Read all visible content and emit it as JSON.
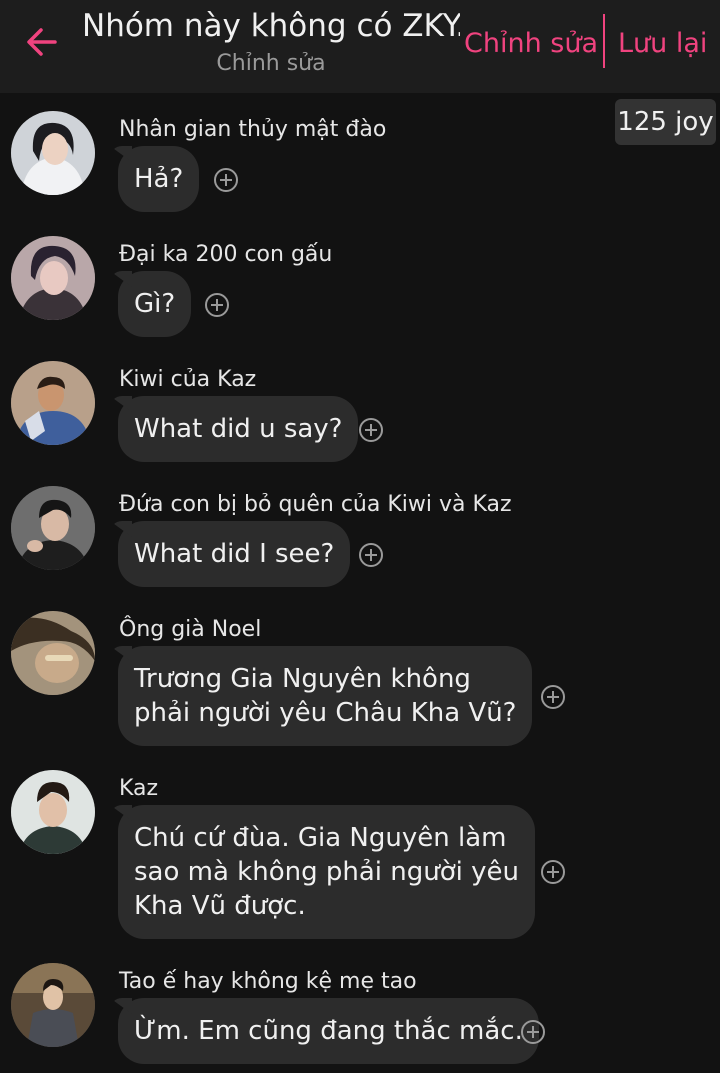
{
  "header": {
    "title": "Nhóm này không có ZKY...",
    "subtitle": "Chỉnh sửa",
    "edit_label": "Chỉnh sửa",
    "save_label": "Lưu lại",
    "back_icon": "arrow-left-icon",
    "accent_color": "#f0437f"
  },
  "badge": {
    "label": "125 joy"
  },
  "messages": [
    {
      "sender": "Nhân gian thủy mật đào",
      "text": "Hả?",
      "avatar_icon": "avatar-photo"
    },
    {
      "sender": "Đại ka 200 con gấu",
      "text": "Gì?",
      "avatar_icon": "avatar-photo"
    },
    {
      "sender": "Kiwi của Kaz",
      "text": "What did u say?",
      "avatar_icon": "avatar-photo"
    },
    {
      "sender": "Đứa con bị bỏ quên của Kiwi và Kaz",
      "text": "What did I see?",
      "avatar_icon": "avatar-photo"
    },
    {
      "sender": "Ông già Noel",
      "text": "Trương Gia Nguyên không\nphải người yêu Châu Kha Vũ?",
      "avatar_icon": "avatar-photo"
    },
    {
      "sender": "Kaz",
      "text": "Chú cứ đùa. Gia Nguyên làm\nsao mà không phải người yêu\nKha Vũ được.",
      "avatar_icon": "avatar-photo"
    },
    {
      "sender": "Tao ế hay không kệ mẹ tao",
      "text": "Ừm. Em cũng đang thắc mắc.",
      "avatar_icon": "avatar-photo"
    }
  ],
  "add_icon": "plus-circle-icon"
}
